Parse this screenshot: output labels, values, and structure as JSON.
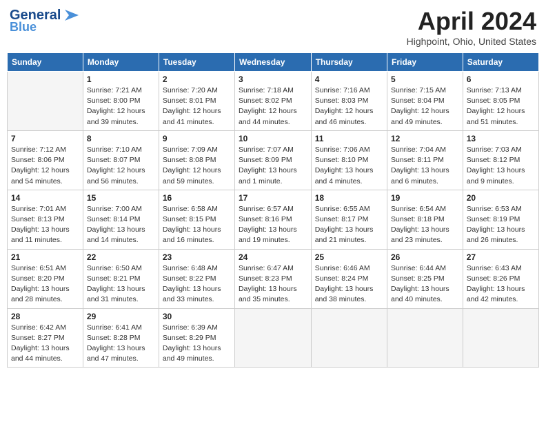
{
  "header": {
    "logo_line1": "General",
    "logo_line2": "Blue",
    "title": "April 2024",
    "location": "Highpoint, Ohio, United States"
  },
  "weekdays": [
    "Sunday",
    "Monday",
    "Tuesday",
    "Wednesday",
    "Thursday",
    "Friday",
    "Saturday"
  ],
  "weeks": [
    [
      {
        "day": "",
        "sunrise": "",
        "sunset": "",
        "daylight": "",
        "empty": true
      },
      {
        "day": "1",
        "sunrise": "Sunrise: 7:21 AM",
        "sunset": "Sunset: 8:00 PM",
        "daylight": "Daylight: 12 hours and 39 minutes."
      },
      {
        "day": "2",
        "sunrise": "Sunrise: 7:20 AM",
        "sunset": "Sunset: 8:01 PM",
        "daylight": "Daylight: 12 hours and 41 minutes."
      },
      {
        "day": "3",
        "sunrise": "Sunrise: 7:18 AM",
        "sunset": "Sunset: 8:02 PM",
        "daylight": "Daylight: 12 hours and 44 minutes."
      },
      {
        "day": "4",
        "sunrise": "Sunrise: 7:16 AM",
        "sunset": "Sunset: 8:03 PM",
        "daylight": "Daylight: 12 hours and 46 minutes."
      },
      {
        "day": "5",
        "sunrise": "Sunrise: 7:15 AM",
        "sunset": "Sunset: 8:04 PM",
        "daylight": "Daylight: 12 hours and 49 minutes."
      },
      {
        "day": "6",
        "sunrise": "Sunrise: 7:13 AM",
        "sunset": "Sunset: 8:05 PM",
        "daylight": "Daylight: 12 hours and 51 minutes."
      }
    ],
    [
      {
        "day": "7",
        "sunrise": "Sunrise: 7:12 AM",
        "sunset": "Sunset: 8:06 PM",
        "daylight": "Daylight: 12 hours and 54 minutes."
      },
      {
        "day": "8",
        "sunrise": "Sunrise: 7:10 AM",
        "sunset": "Sunset: 8:07 PM",
        "daylight": "Daylight: 12 hours and 56 minutes."
      },
      {
        "day": "9",
        "sunrise": "Sunrise: 7:09 AM",
        "sunset": "Sunset: 8:08 PM",
        "daylight": "Daylight: 12 hours and 59 minutes."
      },
      {
        "day": "10",
        "sunrise": "Sunrise: 7:07 AM",
        "sunset": "Sunset: 8:09 PM",
        "daylight": "Daylight: 13 hours and 1 minute."
      },
      {
        "day": "11",
        "sunrise": "Sunrise: 7:06 AM",
        "sunset": "Sunset: 8:10 PM",
        "daylight": "Daylight: 13 hours and 4 minutes."
      },
      {
        "day": "12",
        "sunrise": "Sunrise: 7:04 AM",
        "sunset": "Sunset: 8:11 PM",
        "daylight": "Daylight: 13 hours and 6 minutes."
      },
      {
        "day": "13",
        "sunrise": "Sunrise: 7:03 AM",
        "sunset": "Sunset: 8:12 PM",
        "daylight": "Daylight: 13 hours and 9 minutes."
      }
    ],
    [
      {
        "day": "14",
        "sunrise": "Sunrise: 7:01 AM",
        "sunset": "Sunset: 8:13 PM",
        "daylight": "Daylight: 13 hours and 11 minutes."
      },
      {
        "day": "15",
        "sunrise": "Sunrise: 7:00 AM",
        "sunset": "Sunset: 8:14 PM",
        "daylight": "Daylight: 13 hours and 14 minutes."
      },
      {
        "day": "16",
        "sunrise": "Sunrise: 6:58 AM",
        "sunset": "Sunset: 8:15 PM",
        "daylight": "Daylight: 13 hours and 16 minutes."
      },
      {
        "day": "17",
        "sunrise": "Sunrise: 6:57 AM",
        "sunset": "Sunset: 8:16 PM",
        "daylight": "Daylight: 13 hours and 19 minutes."
      },
      {
        "day": "18",
        "sunrise": "Sunrise: 6:55 AM",
        "sunset": "Sunset: 8:17 PM",
        "daylight": "Daylight: 13 hours and 21 minutes."
      },
      {
        "day": "19",
        "sunrise": "Sunrise: 6:54 AM",
        "sunset": "Sunset: 8:18 PM",
        "daylight": "Daylight: 13 hours and 23 minutes."
      },
      {
        "day": "20",
        "sunrise": "Sunrise: 6:53 AM",
        "sunset": "Sunset: 8:19 PM",
        "daylight": "Daylight: 13 hours and 26 minutes."
      }
    ],
    [
      {
        "day": "21",
        "sunrise": "Sunrise: 6:51 AM",
        "sunset": "Sunset: 8:20 PM",
        "daylight": "Daylight: 13 hours and 28 minutes."
      },
      {
        "day": "22",
        "sunrise": "Sunrise: 6:50 AM",
        "sunset": "Sunset: 8:21 PM",
        "daylight": "Daylight: 13 hours and 31 minutes."
      },
      {
        "day": "23",
        "sunrise": "Sunrise: 6:48 AM",
        "sunset": "Sunset: 8:22 PM",
        "daylight": "Daylight: 13 hours and 33 minutes."
      },
      {
        "day": "24",
        "sunrise": "Sunrise: 6:47 AM",
        "sunset": "Sunset: 8:23 PM",
        "daylight": "Daylight: 13 hours and 35 minutes."
      },
      {
        "day": "25",
        "sunrise": "Sunrise: 6:46 AM",
        "sunset": "Sunset: 8:24 PM",
        "daylight": "Daylight: 13 hours and 38 minutes."
      },
      {
        "day": "26",
        "sunrise": "Sunrise: 6:44 AM",
        "sunset": "Sunset: 8:25 PM",
        "daylight": "Daylight: 13 hours and 40 minutes."
      },
      {
        "day": "27",
        "sunrise": "Sunrise: 6:43 AM",
        "sunset": "Sunset: 8:26 PM",
        "daylight": "Daylight: 13 hours and 42 minutes."
      }
    ],
    [
      {
        "day": "28",
        "sunrise": "Sunrise: 6:42 AM",
        "sunset": "Sunset: 8:27 PM",
        "daylight": "Daylight: 13 hours and 44 minutes."
      },
      {
        "day": "29",
        "sunrise": "Sunrise: 6:41 AM",
        "sunset": "Sunset: 8:28 PM",
        "daylight": "Daylight: 13 hours and 47 minutes."
      },
      {
        "day": "30",
        "sunrise": "Sunrise: 6:39 AM",
        "sunset": "Sunset: 8:29 PM",
        "daylight": "Daylight: 13 hours and 49 minutes."
      },
      {
        "day": "",
        "sunrise": "",
        "sunset": "",
        "daylight": "",
        "empty": true
      },
      {
        "day": "",
        "sunrise": "",
        "sunset": "",
        "daylight": "",
        "empty": true
      },
      {
        "day": "",
        "sunrise": "",
        "sunset": "",
        "daylight": "",
        "empty": true
      },
      {
        "day": "",
        "sunrise": "",
        "sunset": "",
        "daylight": "",
        "empty": true
      }
    ]
  ]
}
